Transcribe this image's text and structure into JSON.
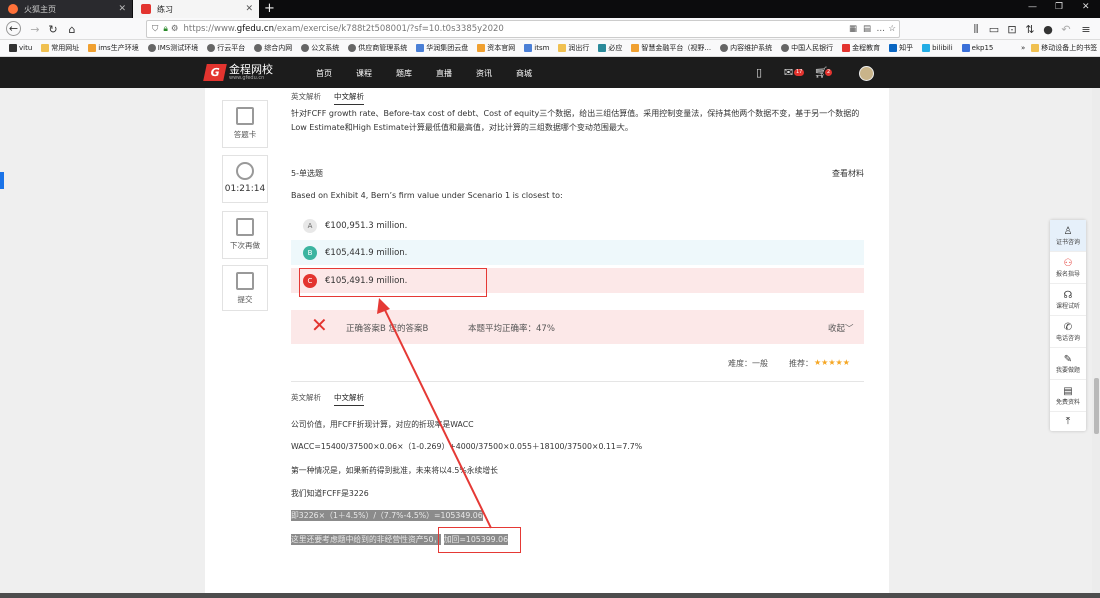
{
  "browser": {
    "tabs": [
      {
        "title": "火狐主页"
      },
      {
        "title": "练习"
      }
    ],
    "url_scheme": "https://www.",
    "url_host": "gfedu.cn",
    "url_path": "/exam/exercise/k788t2t508001/?sf=10.t0s3385y2020",
    "bookmarks": [
      "vitu",
      "常用网址",
      "ims生产环境",
      "IMS测试环境",
      "行云平台",
      "综合内网",
      "公文系统",
      "供应商管理系统",
      "华润集团云盘",
      "资本官网",
      "itsm",
      "润出行",
      "必应",
      "智慧金融平台（视野...",
      "内容维护系统",
      "中国人民银行",
      "金程教育",
      "知乎",
      "bilibili",
      "ekp15"
    ],
    "bookmarks_more": "移动设备上的书签"
  },
  "site": {
    "logo_text": "金程网校",
    "logo_sub": "www.gfedu.cn",
    "nav": [
      "首页",
      "课程",
      "题库",
      "直播",
      "资讯",
      "商城"
    ],
    "msg_badge": "17",
    "cart_badge": "2"
  },
  "left_panel": {
    "answer_card": "答题卡",
    "timer": "01:21:14",
    "later": "下次再做",
    "submit": "提交"
  },
  "prev_section": {
    "tab_en": "英文解析",
    "tab_cn": "中文解析",
    "text_line1": "针对FCFF growth rate、Before-tax cost of debt、Cost of equity三个数据，给出三组估算值。采用控制变量法，保持其他两个数据不变，基于另一个数据的",
    "text_line2": "Low Estimate和High Estimate计算最低值和最高值，对比计算的三组数据哪个变动范围最大。"
  },
  "question": {
    "label": "5-单选题",
    "view_material": "查看材料",
    "text": "Based on Exhibit 4, Bern’s firm value under Scenario 1 is closest to:",
    "options": [
      {
        "letter": "A",
        "text": "€100,951.3 million."
      },
      {
        "letter": "B",
        "text": "€105,441.9 million."
      },
      {
        "letter": "C",
        "text": "€105,491.9 million."
      }
    ]
  },
  "result": {
    "answer_text": "正确答案B 您的答案B",
    "avg_text": "本题平均正确率：47%",
    "collapse": "收起"
  },
  "meta": {
    "difficulty_label": "难度：一般",
    "recommend_label": "推荐："
  },
  "solution": {
    "tab_en": "英文解析",
    "tab_cn": "中文解析",
    "line1": "公司价值，用FCFF折现计算，对应的折现率是WACC",
    "line2": "WACC=15400/37500×0.06×（1-0.269）+4000/37500×0.055＋18100/37500×0.11=7.7%",
    "line3": "第一种情况是，如果新药得到批准，未来将以4.5%永续增长",
    "line4": "我们知道FCFF是3226",
    "line5": "即3226×（1＋4.5%）/（7.7%-4.5%）=105349.06",
    "line6a": "这里还要考虑题中给到的非经营性资产50，",
    "line6b": "加回=105399.06"
  },
  "right_sidebar": [
    "证书咨询",
    "报名指导",
    "课程试听",
    "电话咨询",
    "我要做题",
    "免费资料"
  ],
  "colors": {
    "brand_red": "#e3342f",
    "correct_green": "#3cb4a0",
    "wrong_bg": "#fce8e8",
    "annotation_red": "#e53935"
  }
}
